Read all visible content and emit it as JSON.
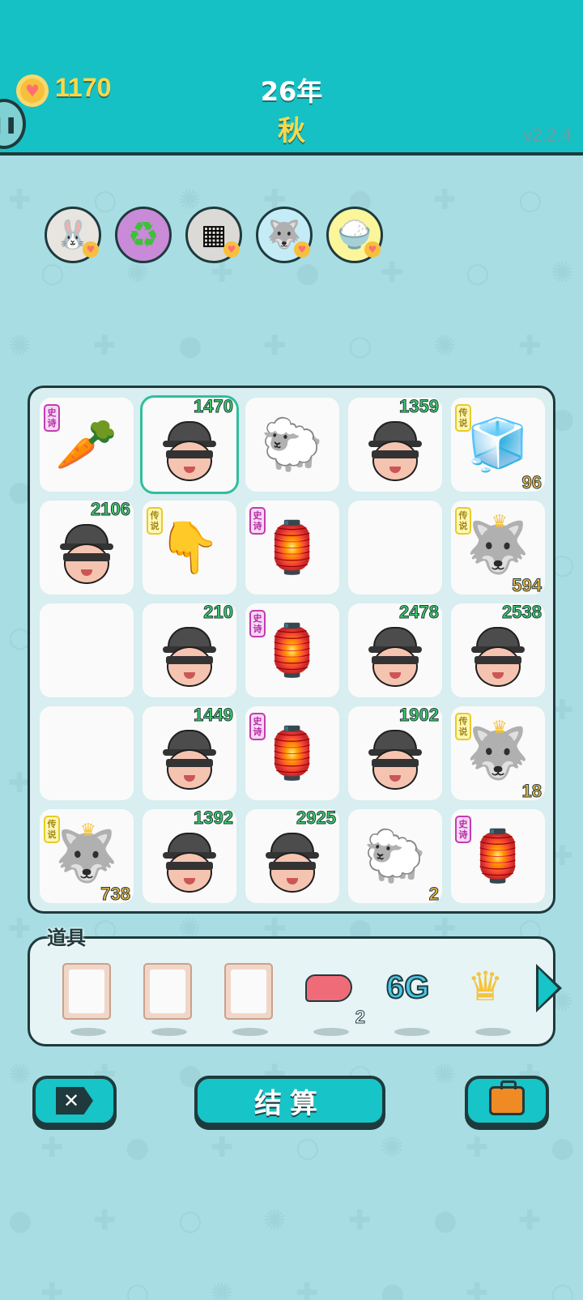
{
  "header": {
    "coins": "1170",
    "year": "26年",
    "season": "秋",
    "version": "v2.2.4",
    "coin_icon": "heart-coin-icon",
    "pause_icon": "pause-icon"
  },
  "relics": [
    {
      "name": "bunny",
      "icon": "🐰",
      "bg": "#e8e4df"
    },
    {
      "name": "recycle",
      "icon": "♻",
      "bg": "#c98ad8"
    },
    {
      "name": "sugar-cubes",
      "icon": "▦",
      "bg": "#dcdad6"
    },
    {
      "name": "husky",
      "icon": "🐺",
      "bg": "#c3ecf7"
    },
    {
      "name": "rice-bowl",
      "icon": "🍚",
      "bg": "#fbf59b"
    }
  ],
  "board": {
    "cells": [
      {
        "type": "carrot",
        "icon": "🥕",
        "tag": "史诗",
        "tag_class": "epic",
        "num": "",
        "cnt": ""
      },
      {
        "type": "thief",
        "icon": "",
        "tag": "",
        "tag_class": "",
        "num": "1470",
        "cnt": "",
        "selected": true
      },
      {
        "type": "sheep",
        "icon": "🐑",
        "tag": "",
        "tag_class": "",
        "num": "",
        "cnt": ""
      },
      {
        "type": "thief",
        "icon": "",
        "tag": "",
        "tag_class": "",
        "num": "1359",
        "cnt": ""
      },
      {
        "type": "fridge",
        "icon": "🧊",
        "tag": "传说",
        "tag_class": "legend",
        "num": "",
        "cnt": "96"
      },
      {
        "type": "thief",
        "icon": "",
        "tag": "",
        "tag_class": "",
        "num": "2106",
        "cnt": ""
      },
      {
        "type": "pointing-hand",
        "icon": "👇",
        "tag": "传说",
        "tag_class": "legend",
        "num": "",
        "cnt": ""
      },
      {
        "type": "rabbit-house",
        "icon": "🏮",
        "tag": "史诗",
        "tag_class": "epic",
        "num": "",
        "cnt": ""
      },
      {
        "type": "empty",
        "icon": "",
        "tag": "",
        "tag_class": "",
        "num": "",
        "cnt": ""
      },
      {
        "type": "husky-king",
        "icon": "🐺",
        "tag": "传说",
        "tag_class": "legend",
        "num": "",
        "cnt": "594"
      },
      {
        "type": "empty",
        "icon": "",
        "tag": "",
        "tag_class": "",
        "num": "",
        "cnt": ""
      },
      {
        "type": "thief",
        "icon": "",
        "tag": "",
        "tag_class": "",
        "num": "210",
        "cnt": ""
      },
      {
        "type": "rabbit-house",
        "icon": "🏮",
        "tag": "史诗",
        "tag_class": "epic",
        "num": "",
        "cnt": ""
      },
      {
        "type": "thief",
        "icon": "",
        "tag": "",
        "tag_class": "",
        "num": "2478",
        "cnt": ""
      },
      {
        "type": "thief",
        "icon": "",
        "tag": "",
        "tag_class": "",
        "num": "2538",
        "cnt": ""
      },
      {
        "type": "empty",
        "icon": "",
        "tag": "",
        "tag_class": "",
        "num": "",
        "cnt": ""
      },
      {
        "type": "thief",
        "icon": "",
        "tag": "",
        "tag_class": "",
        "num": "1449",
        "cnt": ""
      },
      {
        "type": "rabbit-house",
        "icon": "🏮",
        "tag": "史诗",
        "tag_class": "epic",
        "num": "",
        "cnt": ""
      },
      {
        "type": "thief",
        "icon": "",
        "tag": "",
        "tag_class": "",
        "num": "1902",
        "cnt": ""
      },
      {
        "type": "husky-king",
        "icon": "🐺",
        "tag": "传说",
        "tag_class": "legend",
        "num": "",
        "cnt": "18"
      },
      {
        "type": "husky-king",
        "icon": "🐺",
        "tag": "传说",
        "tag_class": "legend",
        "num": "",
        "cnt": "738"
      },
      {
        "type": "thief",
        "icon": "",
        "tag": "",
        "tag_class": "",
        "num": "1392",
        "cnt": ""
      },
      {
        "type": "thief",
        "icon": "",
        "tag": "",
        "tag_class": "",
        "num": "2925",
        "cnt": ""
      },
      {
        "type": "sheep",
        "icon": "🐑",
        "tag": "",
        "tag_class": "",
        "num": "",
        "cnt": "2"
      },
      {
        "type": "rabbit-house",
        "icon": "🏮",
        "tag": "史诗",
        "tag_class": "epic",
        "num": "",
        "cnt": ""
      }
    ]
  },
  "items": {
    "title": "道具",
    "slots": [
      {
        "type": "frame",
        "label": "",
        "count": ""
      },
      {
        "type": "frame",
        "label": "",
        "count": ""
      },
      {
        "type": "frame",
        "label": "",
        "count": ""
      },
      {
        "type": "liver",
        "label": "",
        "count": "2"
      },
      {
        "type": "text",
        "label": "6G",
        "count": ""
      },
      {
        "type": "crown",
        "label": "",
        "count": ""
      }
    ],
    "next_icon": "arrow-right-icon"
  },
  "buttons": {
    "close_icon": "close-icon",
    "settle_label": "结算",
    "bag_icon": "briefcase-icon"
  },
  "colors": {
    "topbar": "#15c1c5",
    "background": "#a9dde4",
    "coin_text": "#f9d84a",
    "number_green": "#3fcf6a",
    "count_orange": "#f5b642"
  }
}
